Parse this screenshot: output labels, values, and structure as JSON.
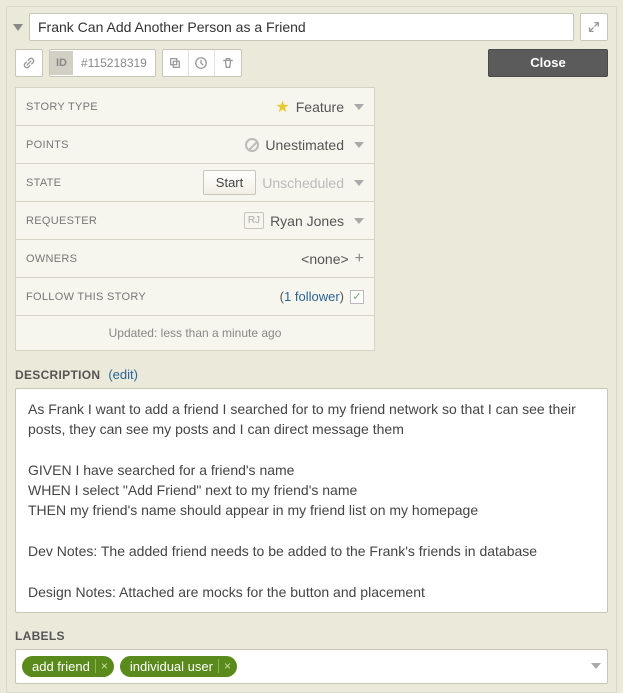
{
  "title": "Frank Can Add Another Person as a Friend",
  "id_label": "ID",
  "id_value": "#115218319",
  "close_label": "Close",
  "meta": {
    "story_type": {
      "label": "STORY TYPE",
      "value": "Feature"
    },
    "points": {
      "label": "POINTS",
      "value": "Unestimated"
    },
    "state": {
      "label": "STATE",
      "start_label": "Start",
      "value": "Unscheduled"
    },
    "requester": {
      "label": "REQUESTER",
      "initials": "RJ",
      "value": "Ryan Jones"
    },
    "owners": {
      "label": "OWNERS",
      "value": "<none>"
    },
    "follow": {
      "label": "FOLLOW THIS STORY",
      "count_text": "1 follower",
      "checked": true
    }
  },
  "updated_text": "Updated: less than a minute ago",
  "description": {
    "header": "DESCRIPTION",
    "edit_label": "edit",
    "body": "As Frank I want to add a friend I searched for to my friend network so that I can see their posts, they can see my posts and I can direct message them\n\nGIVEN I have searched for a friend's name\nWHEN I select \"Add Friend\" next to my friend's name\nTHEN my friend's name should appear in my friend list on my homepage\n\nDev Notes: The added friend needs to be added to the Frank's friends in database\n\nDesign Notes: Attached are mocks for the button and placement"
  },
  "labels": {
    "header": "LABELS",
    "items": [
      "add friend",
      "individual user"
    ]
  }
}
